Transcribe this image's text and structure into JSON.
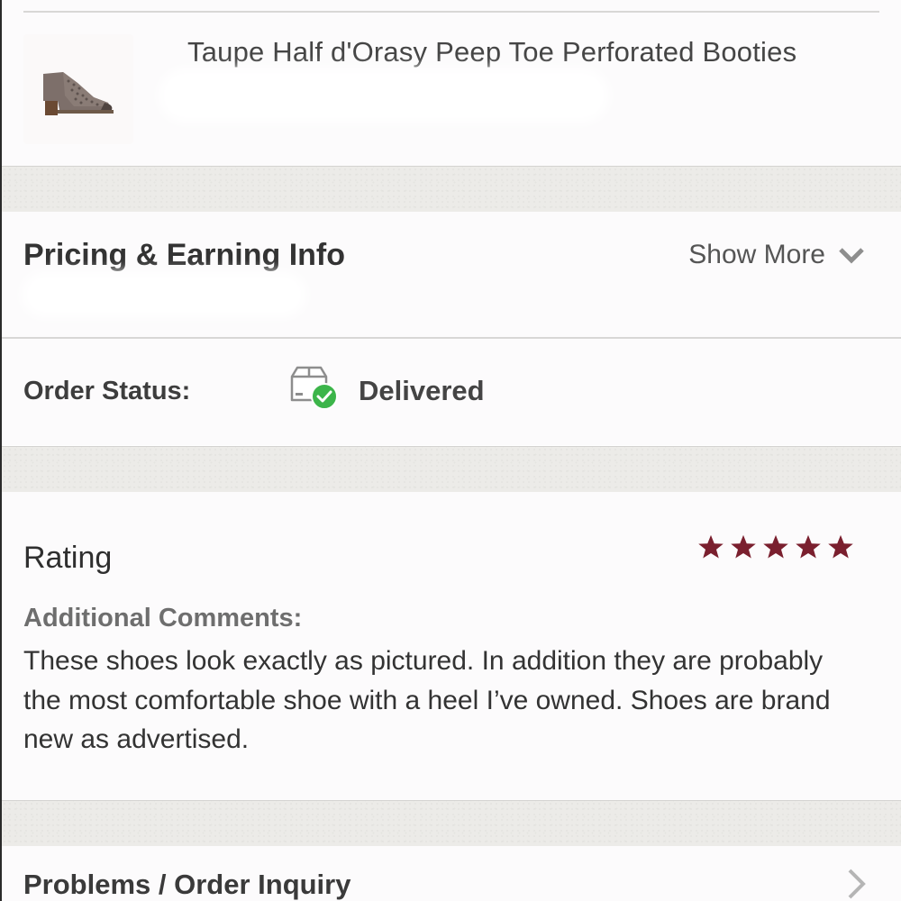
{
  "product": {
    "title": "Taupe Half d'Orasy Peep Toe Perforated Booties",
    "image_icon": "bootie-thumbnail"
  },
  "pricing": {
    "title": "Pricing & Earning Info",
    "show_more_label": "Show More",
    "show_more_icon": "chevron-down-icon"
  },
  "order_status": {
    "label": "Order Status:",
    "value": "Delivered",
    "icon": "package-delivered-icon",
    "check_color": "#3cb54a"
  },
  "rating": {
    "title": "Rating",
    "stars": 5,
    "max_stars": 5,
    "star_color": "#7a1f2e",
    "comments_label": "Additional Comments:",
    "comments_text": "These shoes look exactly as pictured. In addition they are probably the most comfortable shoe with a heel I’ve owned. Shoes are brand new as advertised."
  },
  "problems": {
    "title": "Problems / Order Inquiry",
    "icon": "chevron-right-icon"
  }
}
